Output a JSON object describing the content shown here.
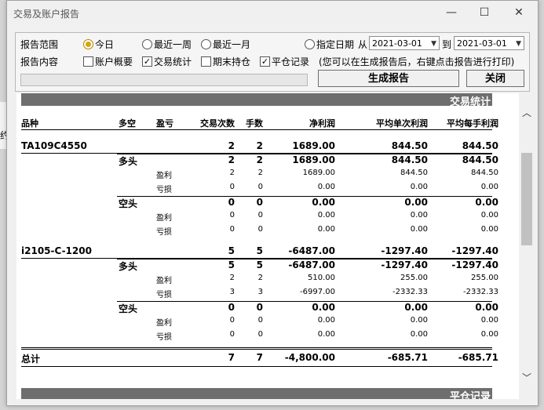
{
  "window": {
    "title": "交易及账户报告",
    "minimize": "—",
    "maximize": "☐",
    "close": "✕"
  },
  "range": {
    "label": "报告范围",
    "today": "今日",
    "week": "最近一周",
    "month": "最近一月",
    "specified": "指定日期",
    "from": "从",
    "to": "到",
    "from_date": "2021-03-01",
    "to_date": "2021-03-01"
  },
  "content": {
    "label": "报告内容",
    "account": "账户概要",
    "trade_stats": "交易统计",
    "holdings": "期末持仓",
    "close_records": "平仓记录",
    "hint": "(您可以在生成报告后，右键点击报告进行打印)"
  },
  "buttons": {
    "generate": "生成报告",
    "close": "关闭"
  },
  "report": {
    "section_title": "交易统计",
    "next_section_title": "平仓记录",
    "columns": [
      "品种",
      "多空",
      "盈亏",
      "交易次数",
      "手数",
      "净利润",
      "平均单次利润",
      "平均每手利润"
    ],
    "rows": [
      {
        "c0": "TA109C4550",
        "c1": "",
        "c2": "",
        "c3": "2",
        "c4": "2",
        "c5": "1689.00",
        "c6": "844.50",
        "c7": "844.50",
        "level": "product"
      },
      {
        "c0": "",
        "c1": "多头",
        "c2": "",
        "c3": "2",
        "c4": "2",
        "c5": "1689.00",
        "c6": "844.50",
        "c7": "844.50",
        "level": "side"
      },
      {
        "c0": "",
        "c1": "",
        "c2": "盈利",
        "c3": "2",
        "c4": "2",
        "c5": "1689.00",
        "c6": "844.50",
        "c7": "844.50",
        "level": "pnl"
      },
      {
        "c0": "",
        "c1": "",
        "c2": "亏损",
        "c3": "0",
        "c4": "0",
        "c5": "0.00",
        "c6": "0.00",
        "c7": "0.00",
        "level": "pnl"
      },
      {
        "c0": "",
        "c1": "空头",
        "c2": "",
        "c3": "0",
        "c4": "0",
        "c5": "0.00",
        "c6": "0.00",
        "c7": "0.00",
        "level": "side"
      },
      {
        "c0": "",
        "c1": "",
        "c2": "盈利",
        "c3": "0",
        "c4": "0",
        "c5": "0.00",
        "c6": "0.00",
        "c7": "0.00",
        "level": "pnl"
      },
      {
        "c0": "",
        "c1": "",
        "c2": "亏损",
        "c3": "0",
        "c4": "0",
        "c5": "0.00",
        "c6": "0.00",
        "c7": "0.00",
        "level": "pnl"
      },
      {
        "c0": "i2105-C-1200",
        "c1": "",
        "c2": "",
        "c3": "5",
        "c4": "5",
        "c5": "-6487.00",
        "c6": "-1297.40",
        "c7": "-1297.40",
        "level": "product"
      },
      {
        "c0": "",
        "c1": "多头",
        "c2": "",
        "c3": "5",
        "c4": "5",
        "c5": "-6487.00",
        "c6": "-1297.40",
        "c7": "-1297.40",
        "level": "side"
      },
      {
        "c0": "",
        "c1": "",
        "c2": "盈利",
        "c3": "2",
        "c4": "2",
        "c5": "510.00",
        "c6": "255.00",
        "c7": "255.00",
        "level": "pnl"
      },
      {
        "c0": "",
        "c1": "",
        "c2": "亏损",
        "c3": "3",
        "c4": "3",
        "c5": "-6997.00",
        "c6": "-2332.33",
        "c7": "-2332.33",
        "level": "pnl"
      },
      {
        "c0": "",
        "c1": "空头",
        "c2": "",
        "c3": "0",
        "c4": "0",
        "c5": "0.00",
        "c6": "0.00",
        "c7": "0.00",
        "level": "side"
      },
      {
        "c0": "",
        "c1": "",
        "c2": "盈利",
        "c3": "0",
        "c4": "0",
        "c5": "0.00",
        "c6": "0.00",
        "c7": "0.00",
        "level": "pnl"
      },
      {
        "c0": "",
        "c1": "",
        "c2": "亏损",
        "c3": "0",
        "c4": "0",
        "c5": "0.00",
        "c6": "0.00",
        "c7": "0.00",
        "level": "pnl"
      }
    ],
    "total": {
      "label": "总计",
      "trades": "7",
      "lots": "7",
      "net": "-4,800.00",
      "avg_trade": "-685.71",
      "avg_lot": "-685.71"
    }
  },
  "background": {
    "edge_text_1": "约",
    "edge_text_2": "析"
  }
}
